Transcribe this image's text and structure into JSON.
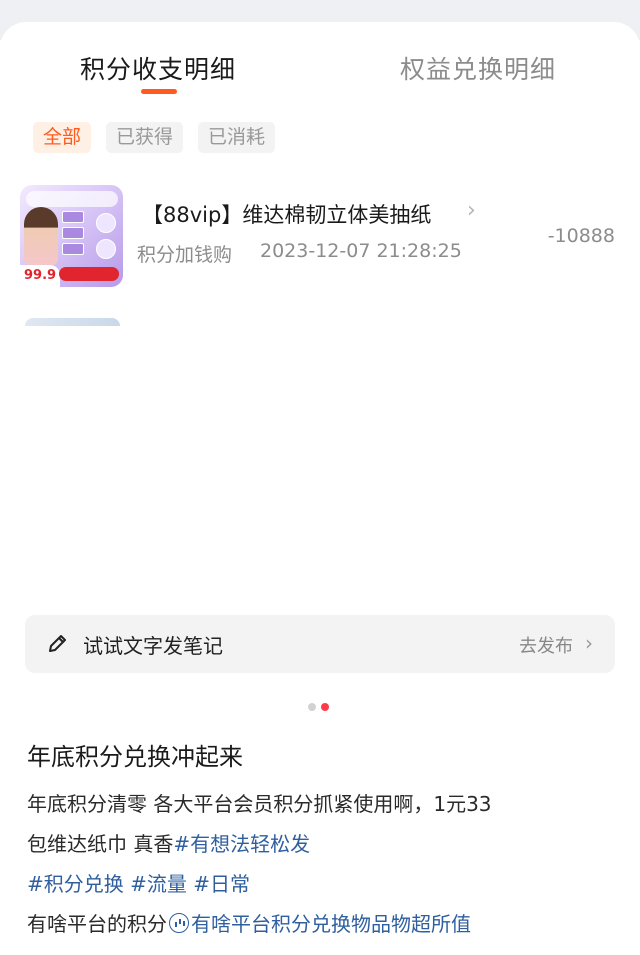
{
  "tabs": [
    {
      "label": "积分收支明细",
      "active": true
    },
    {
      "label": "权益兑换明细",
      "active": false
    }
  ],
  "filters": [
    {
      "label": "全部",
      "active": true
    },
    {
      "label": "已获得",
      "active": false
    },
    {
      "label": "已消耗",
      "active": false
    }
  ],
  "record": {
    "title": "【88vip】维达棉韧立体美抽纸",
    "chevron": "›",
    "type": "积分加钱购",
    "time": "2023-12-07 21:28:25",
    "points": "-10888",
    "thumb_price": "99.9"
  },
  "note_bar": {
    "label": "试试文字发笔记",
    "action": "去发布",
    "chevron": "›"
  },
  "carousel": {
    "count": 2,
    "active_index": 1
  },
  "post": {
    "title": "年底积分兑换冲起来",
    "line1": "年底积分清零 各大平台会员积分抓紧使用啊，1元33",
    "line2_text": "包维达纸巾 真香",
    "line2_tag": "#有想法轻松发",
    "tags": [
      "#积分兑换",
      "#流量",
      "#日常"
    ],
    "line4_text": "有啥平台的积分",
    "line4_link": "有啥平台积分兑换物品物超所值"
  },
  "colors": {
    "accent": "#ff5a1f",
    "tag": "#2f5f9e",
    "muted": "#8c8c8c",
    "dot_active": "#ff3b4a"
  }
}
